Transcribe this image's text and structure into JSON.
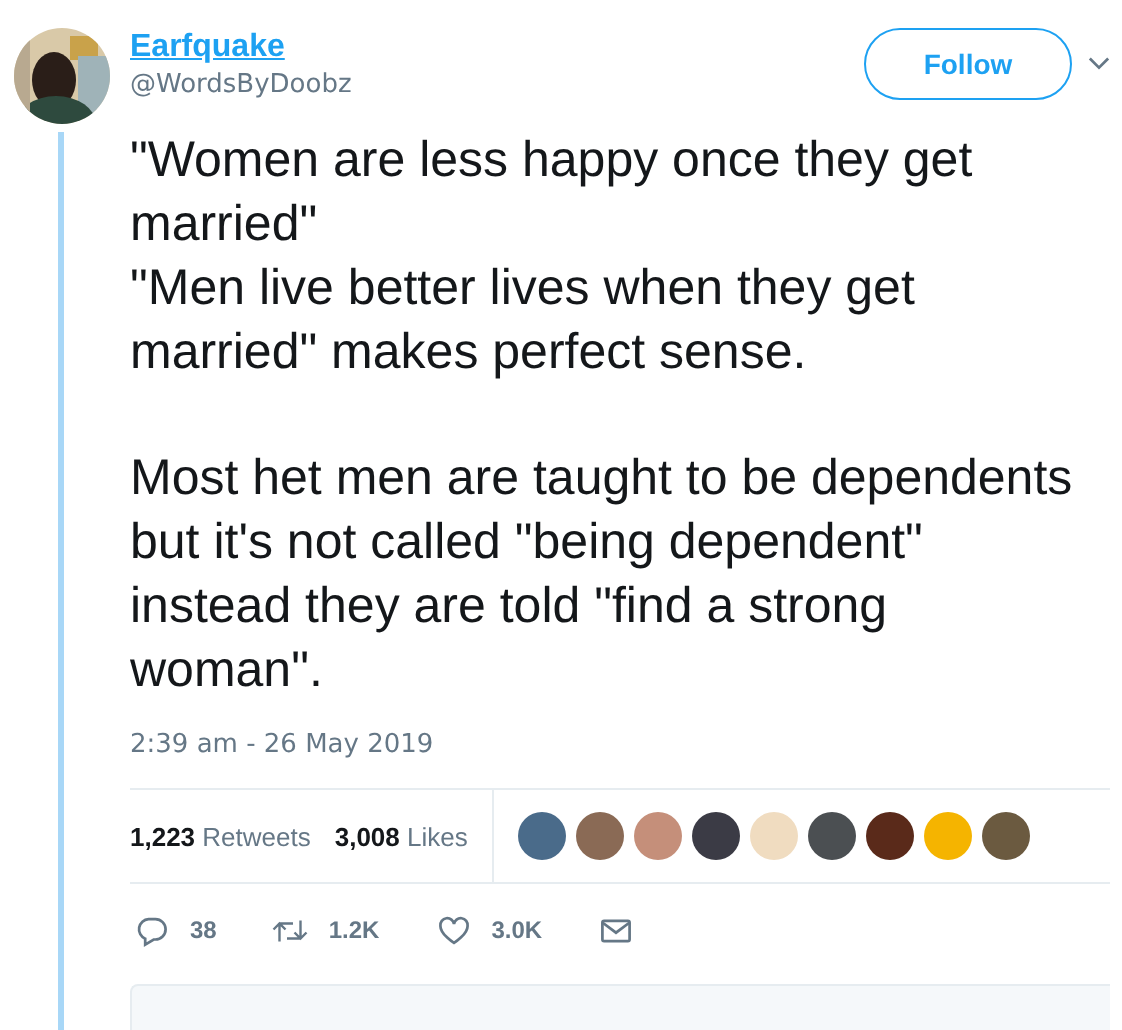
{
  "author": {
    "name": "Earfquake",
    "handle": "@WordsByDoobz"
  },
  "follow_button": "Follow",
  "text": {
    "paragraphs": [
      [
        "\"Women are less happy once they get married\"",
        "\"Men live better lives when they get married\" makes perfect sense."
      ],
      [
        "Most het men are taught to be dependents but it's not called \"being dependent\" instead they are told \"find a strong woman\"."
      ]
    ]
  },
  "timestamp": "2:39 am - 26 May 2019",
  "stats": [
    {
      "count": "1,223",
      "label": "Retweets"
    },
    {
      "count": "3,008",
      "label": "Likes"
    }
  ],
  "likers": [
    {
      "color": "#4a6b8a"
    },
    {
      "color": "#8a6a55"
    },
    {
      "color": "#c58f7a"
    },
    {
      "color": "#3b3b45"
    },
    {
      "color": "#f0dcc0"
    },
    {
      "color": "#4b4f52"
    },
    {
      "color": "#5a2a1a"
    },
    {
      "color": "#f5b400"
    },
    {
      "color": "#6b5a40"
    }
  ],
  "actions": [
    {
      "kind": "reply",
      "count": "38"
    },
    {
      "kind": "retweet",
      "count": "1.2K"
    },
    {
      "kind": "like",
      "count": "3.0K"
    },
    {
      "kind": "message"
    }
  ]
}
